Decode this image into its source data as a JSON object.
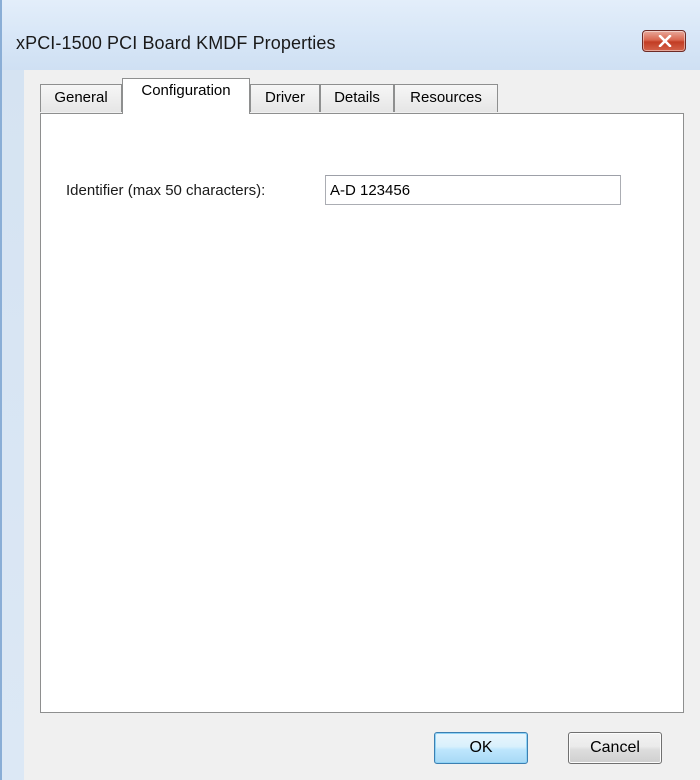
{
  "window": {
    "title": "xPCI-1500 PCI Board KMDF Properties",
    "close_icon": "close-icon"
  },
  "tabs": [
    {
      "label": "General",
      "active": false
    },
    {
      "label": "Configuration",
      "active": true
    },
    {
      "label": "Driver",
      "active": false
    },
    {
      "label": "Details",
      "active": false
    },
    {
      "label": "Resources",
      "active": false
    }
  ],
  "configuration": {
    "identifier_label": "Identifier (max 50 characters):",
    "identifier_value": "A-D 123456"
  },
  "buttons": {
    "ok_label": "OK",
    "cancel_label": "Cancel"
  },
  "colors": {
    "close_button": "#c23d24",
    "default_button_border": "#3c7fb1"
  }
}
